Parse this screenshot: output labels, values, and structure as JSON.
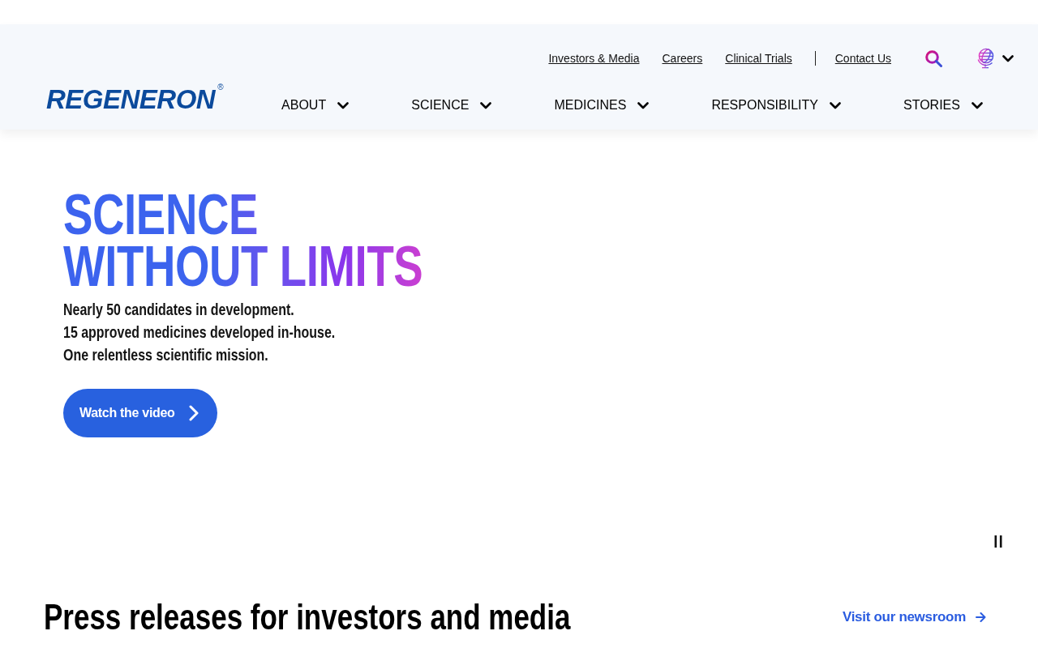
{
  "header": {
    "logo": {
      "wordmark": "REGENERON",
      "registered_mark": "®"
    },
    "utility_links": [
      "Investors & Media",
      "Careers",
      "Clinical Trials"
    ],
    "contact_link": "Contact Us",
    "nav": [
      "ABOUT",
      "SCIENCE",
      "MEDICINES",
      "RESPONSIBILITY",
      "STORIES"
    ]
  },
  "hero": {
    "headline": "SCIENCE WITHOUT LIMITS",
    "lines": [
      "Nearly 50 candidates in development.",
      "15 approved medicines developed in-house.",
      "One relentless scientific mission."
    ],
    "button": "Watch the video"
  },
  "press": {
    "heading": "Press releases for investors and media",
    "link": "Visit our newsroom"
  }
}
